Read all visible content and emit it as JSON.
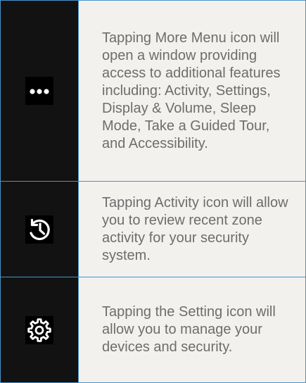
{
  "rows": [
    {
      "icon": "more-horizontal-icon",
      "text": "Tapping More Menu icon will open a window providing access to additional features including: Activity, Settings, Display & Volume, Sleep Mode, Take a Guided Tour, and Accessibility."
    },
    {
      "icon": "activity-history-icon",
      "text": "Tapping Activity icon will allow you to review recent zone activity for your security system."
    },
    {
      "icon": "settings-gear-icon",
      "text": "Tapping the Setting icon will allow you to manage your devices and security."
    }
  ],
  "colors": {
    "border": "#4a92c9",
    "icon_column": "#121212",
    "text_background": "#f2f1ee",
    "text": "#6d6d6d",
    "icon_glyph": "#ffffff"
  }
}
